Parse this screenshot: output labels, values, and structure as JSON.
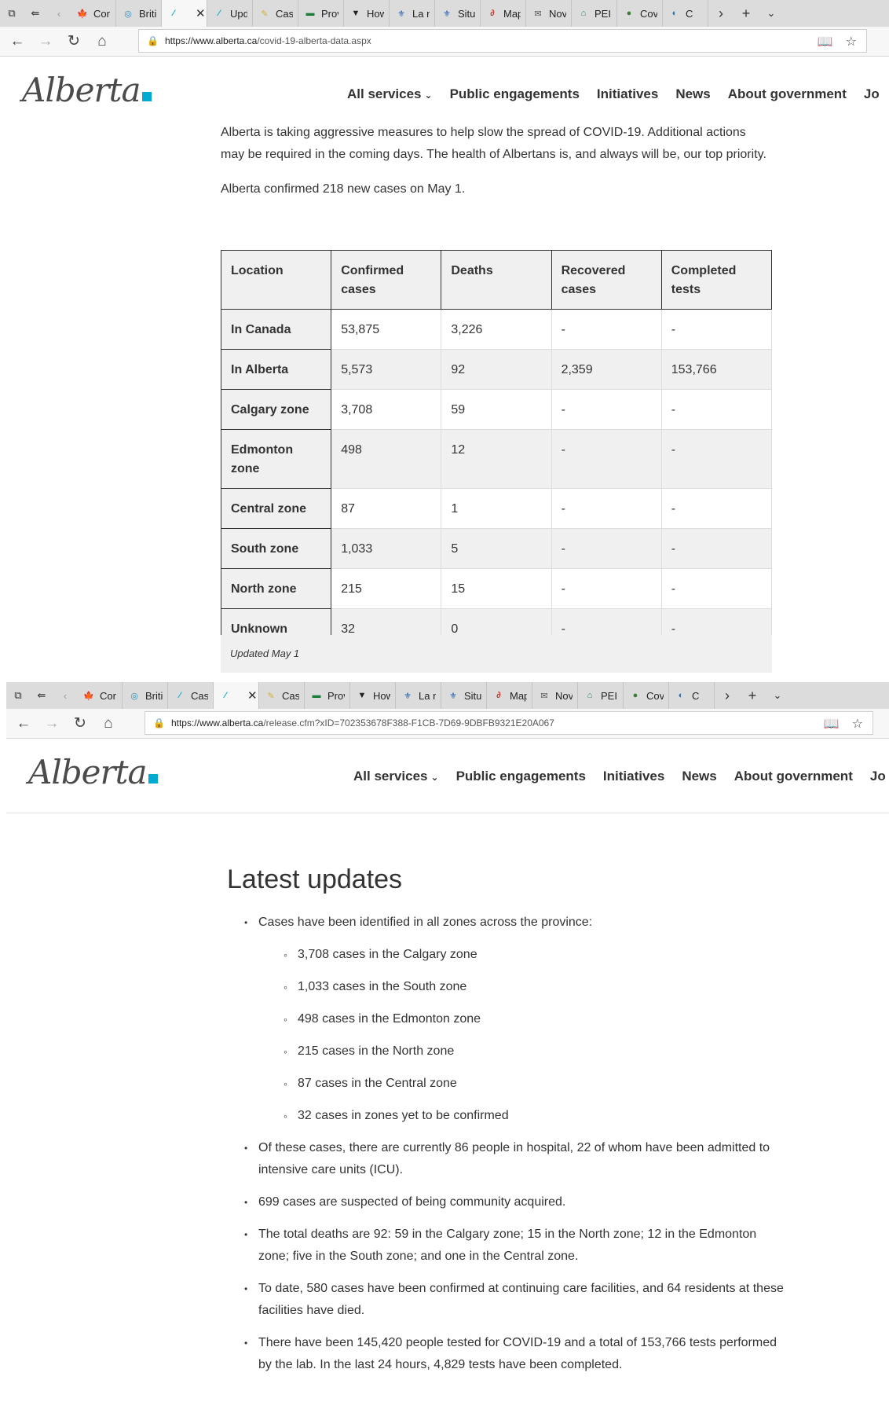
{
  "screenshot1": {
    "tabs": [
      {
        "title": "Cor",
        "icon": "maple-leaf-icon",
        "color": "#d52b1e"
      },
      {
        "title": "Briti",
        "icon": "bc-icon",
        "color": "#2a8fbd"
      },
      {
        "title": "",
        "icon": "alberta-icon",
        "color": "#00aad2",
        "active": true
      },
      {
        "title": "Upd",
        "icon": "alberta-icon",
        "color": "#00aad2"
      },
      {
        "title": "Case",
        "icon": "saskatchewan-icon",
        "color": "#d6b12b"
      },
      {
        "title": "Prov",
        "icon": "manitoba-icon",
        "color": "#1b7c3a"
      },
      {
        "title": "How",
        "icon": "ontario-icon",
        "color": "#222222"
      },
      {
        "title": "La n",
        "icon": "quebec-icon",
        "color": "#1f5fae"
      },
      {
        "title": "Situ",
        "icon": "quebec-icon",
        "color": "#1f5fae"
      },
      {
        "title": "Map",
        "icon": "newbrunswick-icon",
        "color": "#c0392b"
      },
      {
        "title": "Nov",
        "icon": "novascotia-icon",
        "color": "#555555"
      },
      {
        "title": "PEI",
        "icon": "pei-icon",
        "color": "#2e8b57"
      },
      {
        "title": "Cov",
        "icon": "globe-icon",
        "color": "#3c7d3a"
      },
      {
        "title": "C",
        "icon": "nl-icon",
        "color": "#2a6fb3"
      }
    ],
    "url": {
      "host": "https://www.alberta.ca",
      "path": "/covid-19-alberta-data.aspx"
    },
    "logo": "Alberta",
    "nav": [
      "All services",
      "Public engagements",
      "Initiatives",
      "News",
      "About government",
      "Jo"
    ],
    "intro": "Alberta is taking aggressive measures to help slow the spread of COVID-19. Additional actions may be required in the coming days. The health of Albertans is, and always will be, our top priority.",
    "confirmed": "Alberta confirmed 218 new cases on May 1.",
    "table": {
      "headers": [
        "Location",
        "Confirmed cases",
        "Deaths",
        "Recovered cases",
        "Completed tests"
      ],
      "rows": [
        [
          "In Canada",
          "53,875",
          "3,226",
          "-",
          "-"
        ],
        [
          "In Alberta",
          "5,573",
          "92",
          "2,359",
          "153,766"
        ],
        [
          "Calgary zone",
          "3,708",
          "59",
          "-",
          "-"
        ],
        [
          "Edmonton zone",
          "498",
          "12",
          "-",
          "-"
        ],
        [
          "Central zone",
          "87",
          "1",
          "-",
          "-"
        ],
        [
          "South zone",
          "1,033",
          "5",
          "-",
          "-"
        ],
        [
          "North zone",
          "215",
          "15",
          "-",
          "-"
        ],
        [
          "Unknown",
          "32",
          "0",
          "-",
          "-"
        ]
      ],
      "caption": "Updated May 1"
    }
  },
  "screenshot2": {
    "tabs": [
      {
        "title": "Cor",
        "icon": "maple-leaf-icon",
        "color": "#d52b1e"
      },
      {
        "title": "Briti",
        "icon": "bc-icon",
        "color": "#2a8fbd"
      },
      {
        "title": "Case",
        "icon": "alberta-icon",
        "color": "#00aad2"
      },
      {
        "title": "",
        "icon": "alberta-icon",
        "color": "#00aad2",
        "active": true
      },
      {
        "title": "Case",
        "icon": "saskatchewan-icon",
        "color": "#d6b12b"
      },
      {
        "title": "Prov",
        "icon": "manitoba-icon",
        "color": "#1b7c3a"
      },
      {
        "title": "How",
        "icon": "ontario-icon",
        "color": "#222222"
      },
      {
        "title": "La n",
        "icon": "quebec-icon",
        "color": "#1f5fae"
      },
      {
        "title": "Situ",
        "icon": "quebec-icon",
        "color": "#1f5fae"
      },
      {
        "title": "Map",
        "icon": "newbrunswick-icon",
        "color": "#c0392b"
      },
      {
        "title": "Nov",
        "icon": "novascotia-icon",
        "color": "#555555"
      },
      {
        "title": "PEI",
        "icon": "pei-icon",
        "color": "#2e8b57"
      },
      {
        "title": "Cov",
        "icon": "globe-icon",
        "color": "#3c7d3a"
      },
      {
        "title": "C",
        "icon": "nl-icon",
        "color": "#2a6fb3"
      }
    ],
    "url": {
      "host": "https://www.alberta.ca",
      "path": "/release.cfm?xID=702353678F388-F1CB-7D69-9DBFB9321E20A067"
    },
    "logo": "Alberta",
    "nav": [
      "All services",
      "Public engagements",
      "Initiatives",
      "News",
      "About government",
      "Jo"
    ],
    "heading": "Latest updates",
    "updates": {
      "zones_intro": "Cases have been identified in all zones across the province:",
      "zones": [
        "3,708 cases in the Calgary zone",
        "1,033 cases in the South zone",
        "498 cases in the Edmonton zone",
        "215 cases in the North zone",
        "87 cases in the Central zone",
        "32 cases in zones yet to be confirmed"
      ],
      "items": [
        "Of these cases, there are currently 86 people in hospital, 22 of whom have been admitted to intensive care units (ICU).",
        "699 cases are suspected of being community acquired.",
        "The total deaths are 92: 59 in the Calgary zone; 15 in the North zone; 12 in the Edmonton zone; five in the South zone; and one in the Central zone.",
        "To date, 580 cases have been confirmed at continuing care facilities, and 64 residents at these facilities have died.",
        "There have been 145,420 people tested for COVID-19 and a total of 153,766 tests performed by the lab. In the last 24 hours, 4,829 tests have been completed."
      ]
    }
  }
}
